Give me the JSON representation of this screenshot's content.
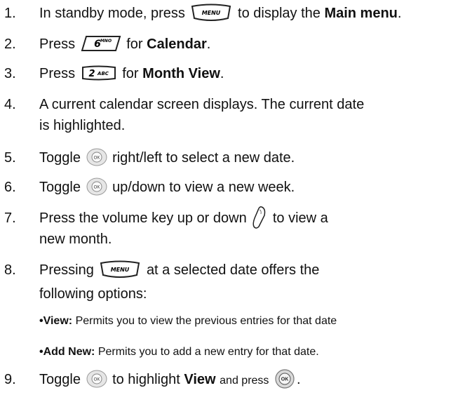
{
  "steps": {
    "s1": {
      "num": "1.",
      "a": "In standby mode, press",
      "b": "to display the",
      "bold": "Main menu",
      "end": "."
    },
    "s2": {
      "num": "2.",
      "a": "Press",
      "b": "for",
      "bold": "Calendar",
      "end": "."
    },
    "s3": {
      "num": "3.",
      "a": "Press",
      "b": "for",
      "bold": "Month View",
      "end": "."
    },
    "s4": {
      "num": "4.",
      "line1": "A current calendar screen displays. The current date",
      "line2": "is highlighted."
    },
    "s5": {
      "num": "5.",
      "a": "Toggle",
      "b": "right/left to select a new date."
    },
    "s6": {
      "num": "6.",
      "a": "Toggle",
      "b": "up/down to view a new week."
    },
    "s7": {
      "num": "7.",
      "a": "Press the volume key up or down",
      "b": "to view a",
      "line2": "new month."
    },
    "s8": {
      "num": "8.",
      "a": "Pressing",
      "b": "at a selected date offers the",
      "line2": "following options:"
    },
    "s9": {
      "num": "9.",
      "a": "Toggle",
      "b": "to highlight",
      "bold": "View",
      "c": "and press",
      "end": "."
    }
  },
  "options": [
    {
      "bold": "•View:",
      "text": "Permits you to view the previous entries for that date"
    },
    {
      "bold": "•Add New:",
      "text": "Permits you to add a new entry for that date."
    }
  ],
  "keys": {
    "menu": "MENU",
    "six": "6",
    "six_sub": "MNO",
    "two": "2",
    "two_sub": "ABC",
    "ok": "OK"
  },
  "icons": {
    "menu_key": "menu-key-icon",
    "six_key": "six-key-icon",
    "two_key": "two-key-icon",
    "nav_key": "navigation-key-icon",
    "volume_key": "volume-key-icon",
    "ok_key": "ok-key-icon"
  }
}
